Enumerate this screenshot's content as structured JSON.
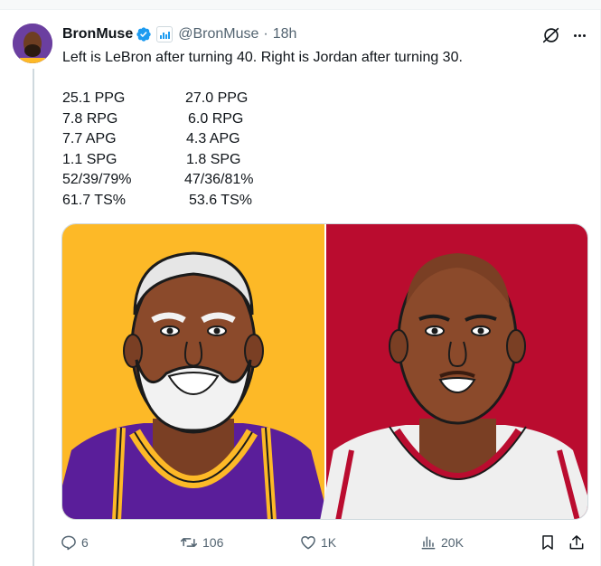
{
  "author": {
    "name": "BronMuse",
    "handle": "@BronMuse",
    "separator": "·",
    "time": "18h"
  },
  "tweet": {
    "text": "Left is LeBron after turning 40. Right is Jordan after turning 30.",
    "stats": [
      {
        "left": "25.1 PPG",
        "right": "27.0 PPG"
      },
      {
        "left": "7.8 RPG",
        "right": "6.0 RPG"
      },
      {
        "left": "7.7 APG",
        "right": "4.3 APG"
      },
      {
        "left": "1.1 SPG",
        "right": "1.8 SPG"
      },
      {
        "left": "52/39/79%",
        "right": "47/36/81%"
      },
      {
        "left": "61.7 TS%",
        "right": "53.6 TS%"
      }
    ]
  },
  "actions": {
    "replies": "6",
    "reposts": "106",
    "likes": "1K",
    "views": "20K"
  },
  "colors": {
    "verified": "#1d9bf0",
    "left_panel": "#fdb927",
    "right_panel": "#ba0c2f",
    "text_secondary": "#536471"
  },
  "icons": [
    "verified-badge-icon",
    "affiliate-badge-icon",
    "grok-icon",
    "more-icon",
    "reply-icon",
    "repost-icon",
    "like-icon",
    "views-icon",
    "bookmark-icon",
    "share-icon"
  ]
}
